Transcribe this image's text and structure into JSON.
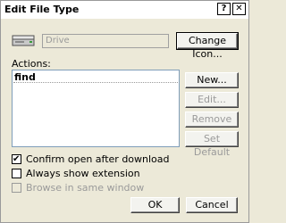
{
  "window": {
    "title": "Edit File Type",
    "help_icon": "?",
    "close_icon": "✕"
  },
  "file_type": {
    "icon": "drive-icon",
    "name_value": "Drive"
  },
  "buttons": {
    "change_icon": "Change Icon...",
    "new": "New...",
    "edit": "Edit...",
    "remove": "Remove",
    "set_default": "Set Default",
    "ok": "OK",
    "cancel": "Cancel"
  },
  "actions": {
    "label": "Actions:",
    "items": [
      "find"
    ]
  },
  "options": {
    "confirm_open": {
      "label": "Confirm open after download",
      "checked": true
    },
    "always_show_extension": {
      "label": "Always show extension",
      "checked": false
    },
    "browse_same_window": {
      "label": "Browse in same window",
      "checked": false,
      "disabled": true
    }
  }
}
